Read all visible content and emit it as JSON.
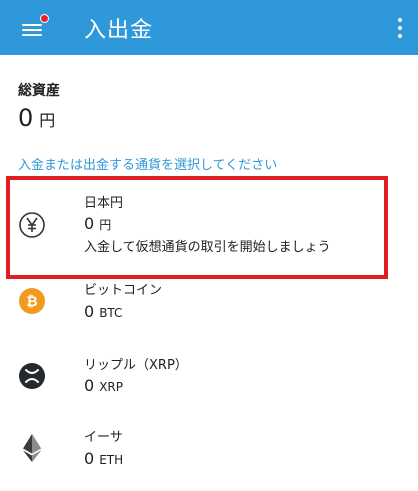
{
  "header": {
    "title": "入出金",
    "background_color": "#2f98db",
    "notification_dot_color": "#e8202a"
  },
  "summary": {
    "label": "総資産",
    "value": "0",
    "unit": "円"
  },
  "instruction": "入金または出金する通貨を選択してください",
  "highlight_color": "#e11d24",
  "currencies": [
    {
      "name": "日本円",
      "amount": "0",
      "unit": "円",
      "description": "入金して仮想通貨の取引を開始しましょう",
      "icon": "yen-icon"
    },
    {
      "name": "ビットコイン",
      "amount": "0",
      "unit": "BTC",
      "icon": "bitcoin-icon",
      "icon_color": "#f29a1f"
    },
    {
      "name": "リップル（XRP）",
      "amount": "0",
      "unit": "XRP",
      "icon": "xrp-icon",
      "icon_color": "#23292f"
    },
    {
      "name": "イーサ",
      "amount": "0",
      "unit": "ETH",
      "icon": "ethereum-icon",
      "icon_color": "#3c3c3d"
    }
  ]
}
